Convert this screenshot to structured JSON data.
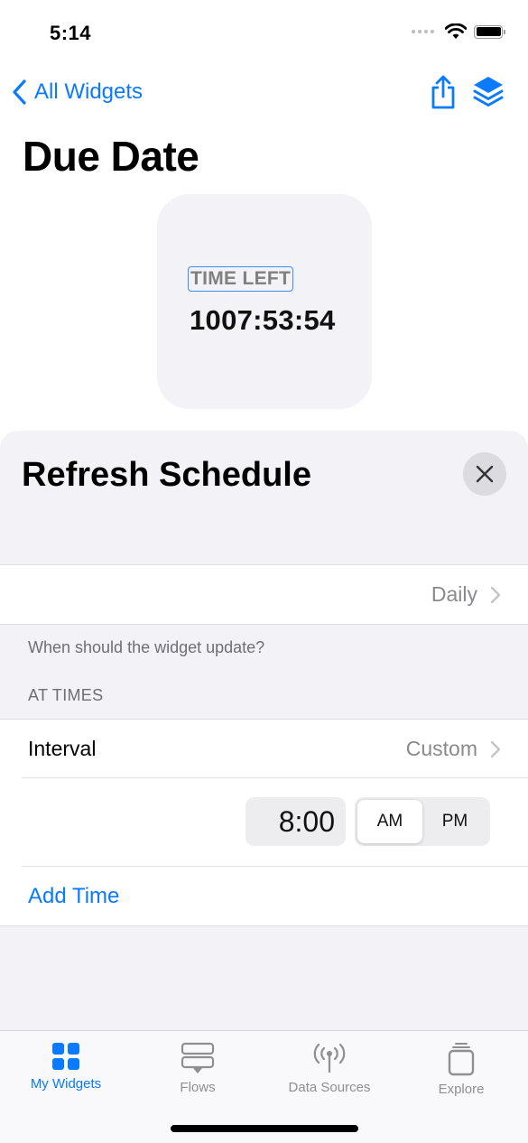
{
  "status_bar": {
    "time": "5:14",
    "icons": [
      "cellular-signal-icon",
      "wifi-icon",
      "battery-icon"
    ]
  },
  "nav": {
    "back_label": "All Widgets",
    "back_icon": "chevron-left-icon",
    "actions": [
      {
        "icon": "share-icon"
      },
      {
        "icon": "layers-icon"
      }
    ]
  },
  "page": {
    "title": "Due Date"
  },
  "widget": {
    "label": "TIME LEFT",
    "value": "1007:53:54"
  },
  "sheet": {
    "title": "Refresh Schedule",
    "close_icon": "close-icon",
    "frequency": {
      "value": "Daily"
    },
    "frequency_footer": "When should the widget update?",
    "section_header": "AT TIMES",
    "interval": {
      "label": "Interval",
      "value": "Custom"
    },
    "time_entry": {
      "time": "8:00",
      "period_options": [
        "AM",
        "PM"
      ],
      "selected_period": "AM"
    },
    "add_time_label": "Add Time"
  },
  "tab_bar": {
    "items": [
      {
        "label": "My Widgets",
        "icon": "grid-icon",
        "active": true
      },
      {
        "label": "Flows",
        "icon": "flows-icon",
        "active": false
      },
      {
        "label": "Data Sources",
        "icon": "antenna-icon",
        "active": false
      },
      {
        "label": "Explore",
        "icon": "explore-stack-icon",
        "active": false
      }
    ]
  },
  "colors": {
    "accent": "#0a7aff",
    "background_grouped": "#f2f2f7",
    "secondary_text": "#8a8a8e"
  }
}
